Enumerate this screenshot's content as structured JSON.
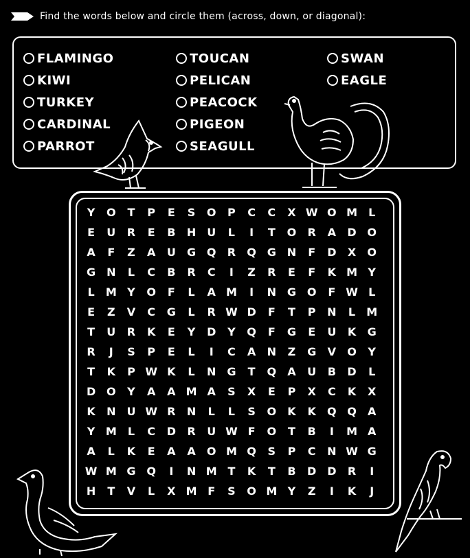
{
  "instructions": "Find the words below and circle them (across, down, or diagonal):",
  "words": [
    "FLAMINGO",
    "TOUCAN",
    "SWAN",
    "KIWI",
    "PELICAN",
    "EAGLE",
    "TURKEY",
    "PEACOCK",
    "CARDINAL",
    "PIGEON",
    "PARROT",
    "SEAGULL"
  ],
  "grid": [
    [
      "Y",
      "O",
      "T",
      "P",
      "E",
      "S",
      "O",
      "P",
      "C",
      "C",
      "X",
      "W",
      "O",
      "M",
      "L"
    ],
    [
      "E",
      "U",
      "R",
      "E",
      "B",
      "H",
      "U",
      "L",
      "I",
      "T",
      "O",
      "R",
      "A",
      "D",
      "O"
    ],
    [
      "A",
      "F",
      "Z",
      "A",
      "U",
      "G",
      "Q",
      "R",
      "Q",
      "G",
      "N",
      "F",
      "D",
      "X",
      "O"
    ],
    [
      "G",
      "N",
      "L",
      "C",
      "B",
      "R",
      "C",
      "I",
      "Z",
      "R",
      "E",
      "F",
      "K",
      "M",
      "Y"
    ],
    [
      "L",
      "M",
      "Y",
      "O",
      "F",
      "L",
      "A",
      "M",
      "I",
      "N",
      "G",
      "O",
      "F",
      "W",
      "L"
    ],
    [
      "E",
      "Z",
      "V",
      "C",
      "G",
      "L",
      "R",
      "W",
      "D",
      "F",
      "T",
      "P",
      "N",
      "L",
      "M"
    ],
    [
      "T",
      "U",
      "R",
      "K",
      "E",
      "Y",
      "D",
      "Y",
      "Q",
      "F",
      "G",
      "E",
      "U",
      "K",
      "G"
    ],
    [
      "R",
      "J",
      "S",
      "P",
      "E",
      "L",
      "I",
      "C",
      "A",
      "N",
      "Z",
      "G",
      "V",
      "O",
      "Y"
    ],
    [
      "T",
      "K",
      "P",
      "W",
      "K",
      "L",
      "N",
      "G",
      "T",
      "Q",
      "A",
      "U",
      "B",
      "D",
      "L"
    ],
    [
      "D",
      "O",
      "Y",
      "A",
      "A",
      "M",
      "A",
      "S",
      "X",
      "E",
      "P",
      "X",
      "C",
      "K",
      "X"
    ],
    [
      "K",
      "N",
      "U",
      "W",
      "R",
      "N",
      "L",
      "L",
      "S",
      "O",
      "K",
      "K",
      "Q",
      "Q",
      "A"
    ],
    [
      "Y",
      "M",
      "L",
      "C",
      "D",
      "R",
      "U",
      "W",
      "F",
      "O",
      "T",
      "B",
      "I",
      "M",
      "A"
    ],
    [
      "A",
      "L",
      "K",
      "E",
      "A",
      "A",
      "O",
      "M",
      "Q",
      "S",
      "P",
      "C",
      "N",
      "W",
      "G"
    ],
    [
      "W",
      "M",
      "G",
      "Q",
      "I",
      "N",
      "M",
      "T",
      "K",
      "T",
      "B",
      "D",
      "D",
      "R",
      "I"
    ],
    [
      "H",
      "T",
      "V",
      "L",
      "X",
      "M",
      "F",
      "S",
      "O",
      "M",
      "Y",
      "Z",
      "I",
      "K",
      "J"
    ]
  ],
  "icons": [
    "arrow-icon",
    "cardinal-icon",
    "turkey-icon",
    "pigeon-icon",
    "parrot-icon"
  ]
}
